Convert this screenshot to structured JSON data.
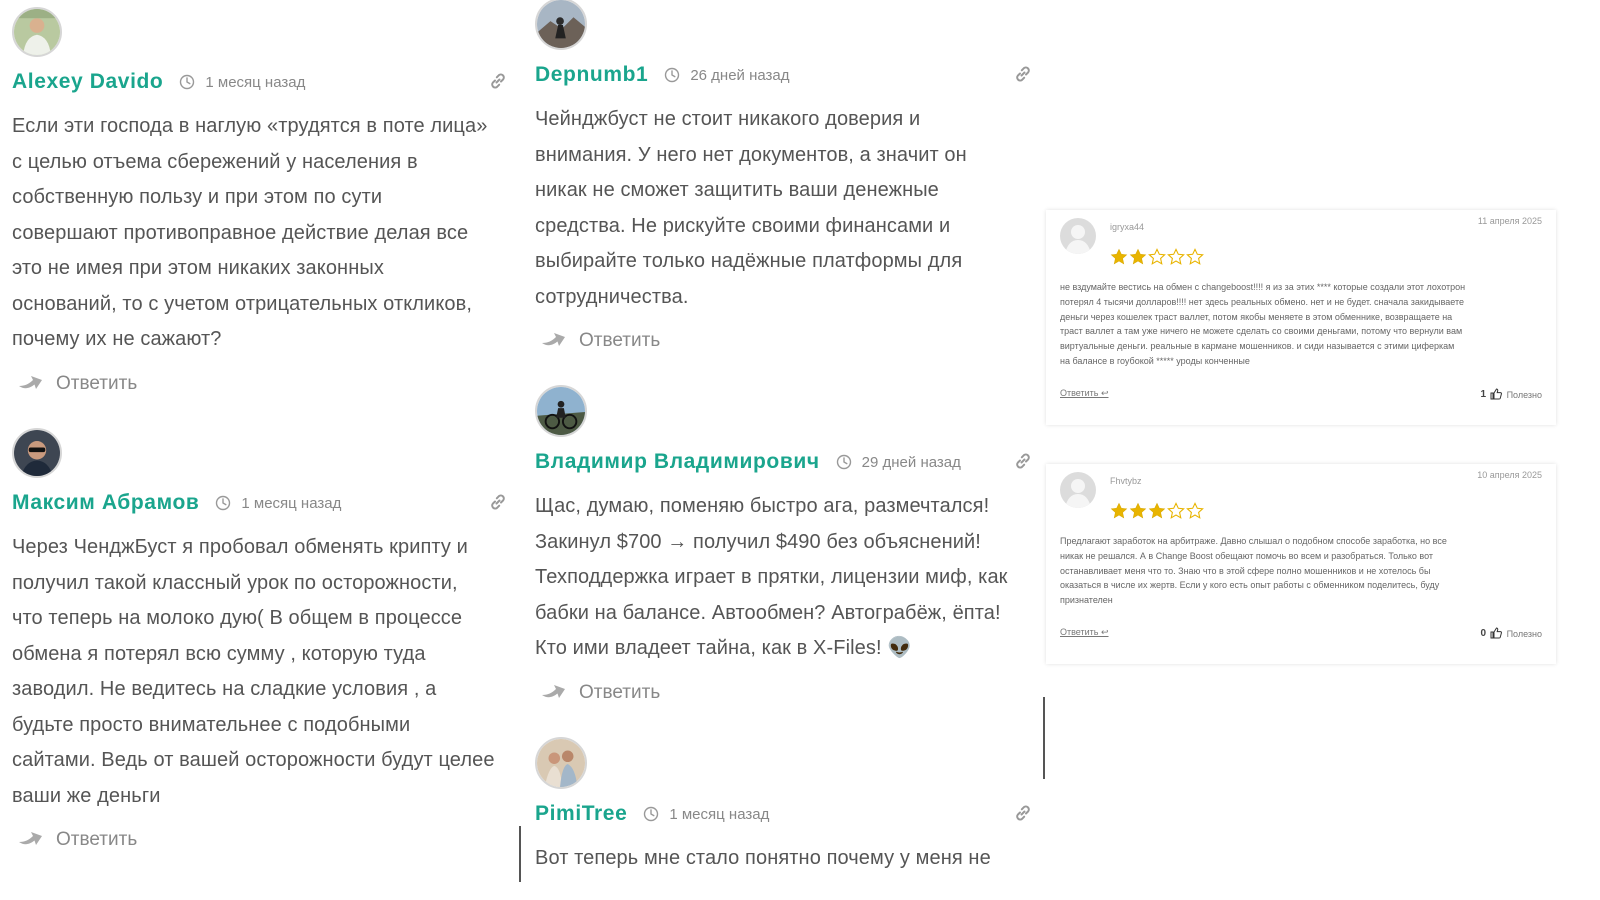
{
  "reply_label": "Ответить",
  "comments": [
    {
      "author": "Alexey Davido",
      "time": "1 месяц назад",
      "lines": [
        "Если эти господа в наглую «трудятся в поте лица»",
        "с целью отъема сбережений у населения в",
        "собственную пользу и при этом по сути",
        "совершают противоправное действие делая все",
        "это не имея при этом никаких законных",
        "оснований, то с учетом отрицательных откликов,",
        "почему их не сажают?"
      ]
    },
    {
      "author": "Максим Абрамов",
      "time": "1 месяц назад",
      "lines": [
        "Через ЧенджБуст я пробовал обменять крипту и",
        "получил такой классный урок по осторожности,",
        "что теперь на молоко дую( В общем в процессе",
        "обмена я потерял всю сумму , которую туда",
        "заводил. Не ведитесь на сладкие условия , а",
        "будьте просто внимательнее с подобными",
        "сайтами. Ведь от вашей осторожности будут целее",
        "ваши же деньги"
      ]
    },
    {
      "author": "Depnumb1",
      "time": "26 дней назад",
      "lines": [
        "Чейнджбуст не стоит никакого доверия и",
        "внимания. У него нет документов, а значит он",
        "никак не сможет защитить ваши денежные",
        "средства. Не рискуйте своими финансами и",
        "выбирайте только надёжные платформы для",
        "сотрудничества."
      ]
    },
    {
      "author": "Владимир Владимирович",
      "time": "29 дней назад",
      "lines": [
        "Щас, думаю, поменяю быстро ага, размечтался!",
        "Закинул $700 → получил $490 без объяснений!",
        "Техподдержка играет в прятки, лицензии миф, как",
        "бабки на балансе. Автообмен? Автограбёж, ёпта!",
        "Кто ими владеет тайна, как в X-Files! 👽"
      ]
    },
    {
      "author": "PimiTree",
      "time": "1 месяц назад",
      "lines": [
        "Вот теперь мне стало понятно почему у меня не"
      ]
    }
  ],
  "reviews": [
    {
      "name": "igryxa44",
      "date": "11 апреля 2025",
      "rating": 2,
      "max_rating": 5,
      "lines": [
        "не вздумайте вестись на обмен с changeboost!!!! я из за этих **** которые создали этот лохотрон",
        "потерял 4 тысячи долларов!!!! нет здесь реальных обмено. нет и не будет. сначала закидываете",
        "деньги через кошелек траст валлет, потом якобы меняете в этом обменнике, возвращаете на",
        "траст валлет а там уже ничего не можете сделать со своими деньгами, потому что вернули вам",
        "виртуальные деньги. реальные в кармане мошенников. и сиди называется с этими циферкам",
        "на балансе в гоубокой ***** уроды конченные"
      ],
      "reply": "Ответить ↩",
      "likes": "1",
      "useful": "Полезно"
    },
    {
      "name": "Fhvtybz",
      "date": "10 апреля 2025",
      "rating": 3,
      "max_rating": 5,
      "lines": [
        "Предлагают заработок на арбитраже. Давно слышал о подобном способе заработка, но все",
        "никак не решался. А в Change Boost обещают помочь во всем и разобраться. Только вот",
        "останавливает меня что то. Знаю что в этой сфере полно мошенников и не хотелось бы",
        "оказаться в числе их жертв. Если у кого есть опыт работы с обменником поделитесь, буду",
        "признателен"
      ],
      "reply": "Ответить ↩",
      "likes": "0",
      "useful": "Полезно"
    }
  ],
  "colors": {
    "author": "#1aa58d",
    "star": "#e8b400",
    "text": "#555555"
  }
}
